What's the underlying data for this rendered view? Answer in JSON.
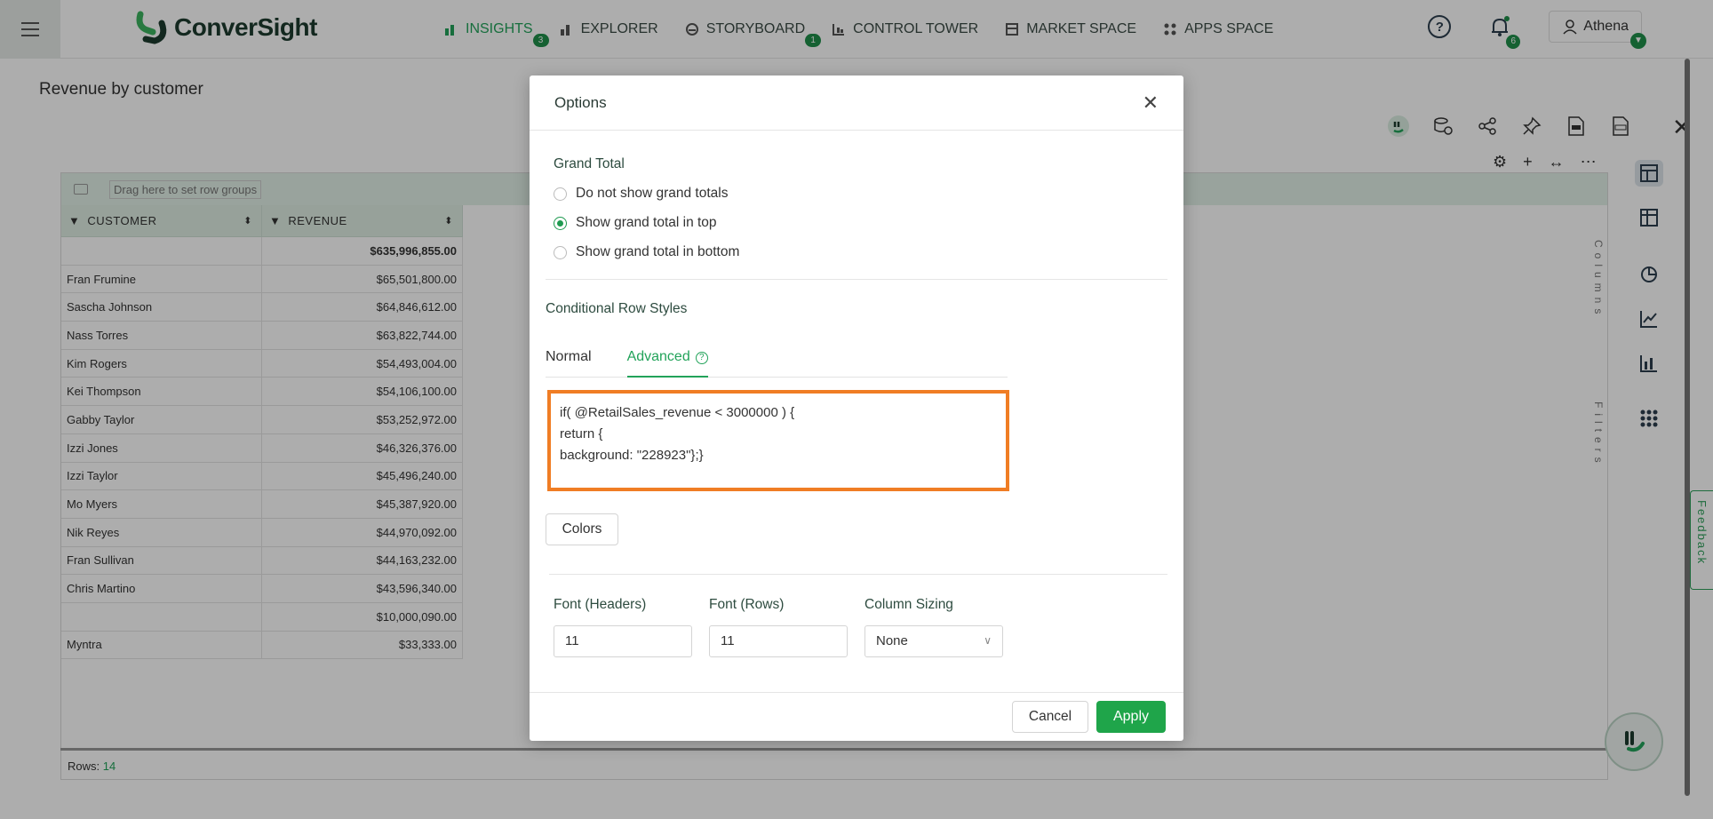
{
  "header": {
    "logo_text": "ConverSight",
    "nav": [
      {
        "label": "INSIGHTS",
        "badge": "3",
        "icon": "bar-chart-icon",
        "active": true
      },
      {
        "label": "EXPLORER",
        "badge": "",
        "icon": "explorer-icon",
        "active": false
      },
      {
        "label": "STORYBOARD",
        "badge": "1",
        "icon": "storyboard-icon",
        "active": false
      },
      {
        "label": "CONTROL TOWER",
        "badge": "",
        "icon": "control-tower-icon",
        "active": false
      },
      {
        "label": "MARKET SPACE",
        "badge": "",
        "icon": "market-space-icon",
        "active": false
      },
      {
        "label": "APPS SPACE",
        "badge": "",
        "icon": "apps-space-icon",
        "active": false
      }
    ],
    "help_label": "?",
    "notification_count": "6",
    "user_name": "Athena"
  },
  "page": {
    "title": "Revenue by customer",
    "group_bar_text": "Drag here to set row groups",
    "columns": [
      "CUSTOMER",
      "REVENUE"
    ],
    "total_row": {
      "customer": "",
      "revenue": "$635,996,855.00"
    },
    "rows": [
      {
        "customer": "Fran Frumine",
        "revenue": "$65,501,800.00"
      },
      {
        "customer": "Sascha Johnson",
        "revenue": "$64,846,612.00"
      },
      {
        "customer": "Nass Torres",
        "revenue": "$63,822,744.00"
      },
      {
        "customer": "Kim Rogers",
        "revenue": "$54,493,004.00"
      },
      {
        "customer": "Kei Thompson",
        "revenue": "$54,106,100.00"
      },
      {
        "customer": "Gabby Taylor",
        "revenue": "$53,252,972.00"
      },
      {
        "customer": "Izzi Jones",
        "revenue": "$46,326,376.00"
      },
      {
        "customer": "Izzi Taylor",
        "revenue": "$45,496,240.00"
      },
      {
        "customer": "Mo Myers",
        "revenue": "$45,387,920.00"
      },
      {
        "customer": "Nik Reyes",
        "revenue": "$44,970,092.00"
      },
      {
        "customer": "Fran Sullivan",
        "revenue": "$44,163,232.00"
      },
      {
        "customer": "Chris Martino",
        "revenue": "$43,596,340.00"
      },
      {
        "customer": "",
        "revenue": "$10,000,090.00"
      },
      {
        "customer": "Myntra",
        "revenue": "$33,333.00"
      }
    ],
    "rows_label": "Rows:",
    "rows_count": "14",
    "side_panel_columns": "Columns",
    "side_panel_filters": "Filters",
    "feedback_label": "Feedback"
  },
  "modal": {
    "title": "Options",
    "grand_total_label": "Grand Total",
    "grand_total_options": [
      {
        "label": "Do not show grand totals",
        "selected": false
      },
      {
        "label": "Show grand total in top",
        "selected": true
      },
      {
        "label": "Show grand total in bottom",
        "selected": false
      }
    ],
    "conditional_label": "Conditional Row Styles",
    "tabs": [
      {
        "label": "Normal",
        "active": false
      },
      {
        "label": "Advanced",
        "active": true
      }
    ],
    "code": "if( @RetailSales_revenue < 3000000 ) {\nreturn {\nbackground: \"228923\"};}",
    "colors_button": "Colors",
    "font_headers_label": "Font (Headers)",
    "font_headers_value": "11",
    "font_rows_label": "Font (Rows)",
    "font_rows_value": "11",
    "column_sizing_label": "Column Sizing",
    "column_sizing_value": "None",
    "cancel_button": "Cancel",
    "apply_button": "Apply"
  },
  "colors": {
    "accent": "#22a35a",
    "apply_bg": "#1fa54a",
    "highlight_border": "#f07d24"
  }
}
